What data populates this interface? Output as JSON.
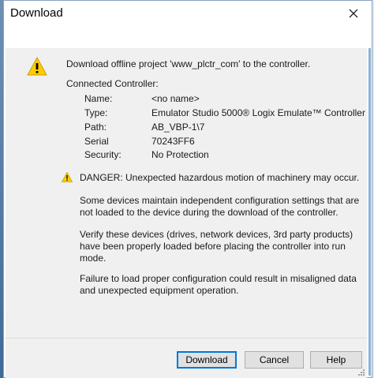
{
  "window": {
    "title": "Download"
  },
  "colors": {
    "warning": "#ffcc00",
    "accent": "#0078d7",
    "client_bg": "#f0f0f0"
  },
  "icons": {
    "close": "close-icon",
    "warning_large": "warning-icon",
    "warning_small": "danger-warning-icon"
  },
  "message": {
    "intro": "Download offline project 'www_plctr_com' to the controller.",
    "connected_heading": "Connected Controller:",
    "fields": [
      {
        "label": "Name:",
        "value": "<no name>"
      },
      {
        "label": "Type:",
        "value": "Emulator Studio 5000® Logix Emulate™ Controller"
      },
      {
        "label": "Path:",
        "value": "AB_VBP-1\\7"
      },
      {
        "label": "Serial",
        "value": "70243FF6"
      },
      {
        "label": "Security:",
        "value": "No Protection"
      }
    ],
    "danger": "DANGER: Unexpected hazardous motion of machinery may occur.",
    "para1": [
      "Some devices maintain independent configuration settings that are",
      "not loaded to the device during the download of the controller."
    ],
    "para2": [
      "Verify these devices (drives, network devices, 3rd party products)",
      "have been properly loaded before placing the controller into run",
      "mode."
    ],
    "para3": [
      "Failure to load proper configuration could result in misaligned data",
      "and unexpected equipment operation."
    ]
  },
  "buttons": {
    "download": "Download",
    "cancel": "Cancel",
    "help": "Help"
  }
}
